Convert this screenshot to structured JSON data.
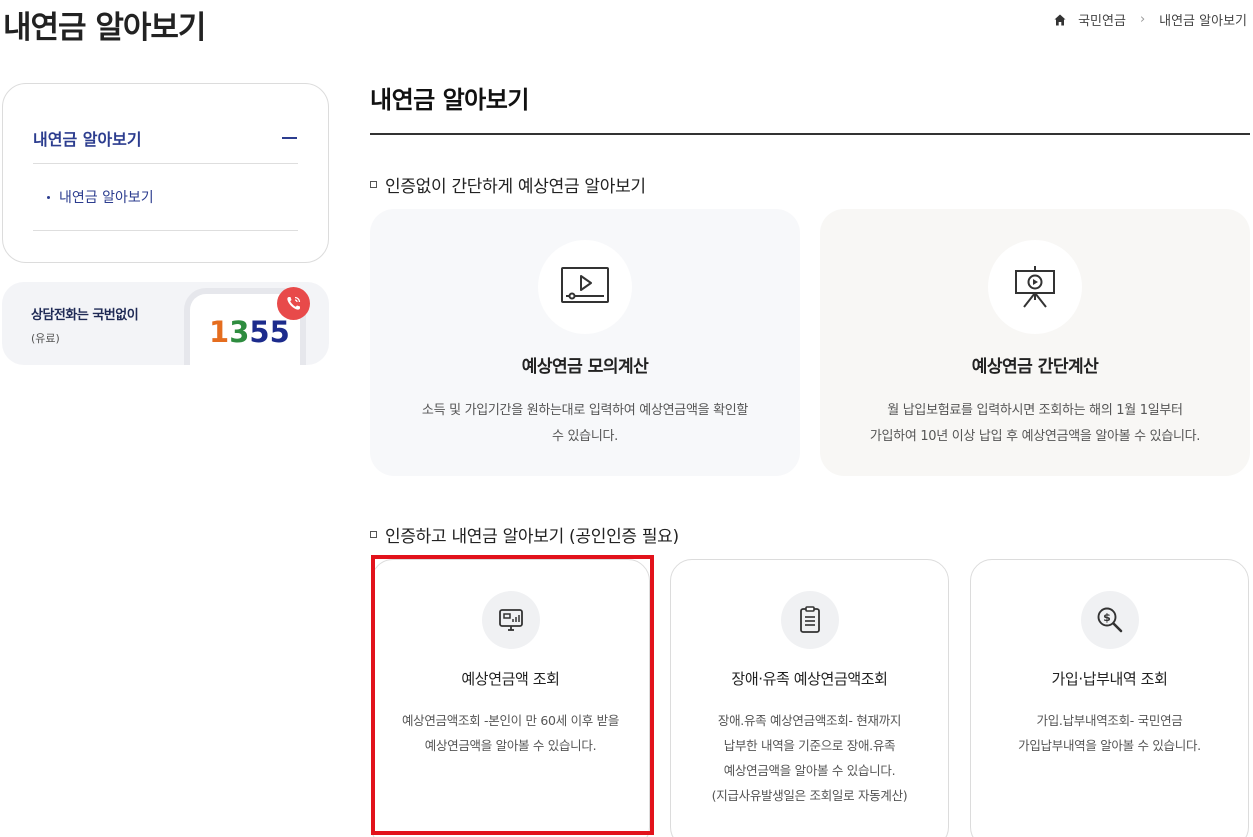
{
  "header": {
    "page_title": "내연금 알아보기",
    "breadcrumb": {
      "home": "국민연금",
      "current": "내연금 알아보기"
    }
  },
  "sidebar": {
    "menu_title": "내연금 알아보기",
    "sub_items": [
      {
        "label": "내연금 알아보기"
      }
    ],
    "call": {
      "title": "상담전화는 국번없이",
      "sub": "(유료)",
      "number_digits": [
        "1",
        "3",
        "5",
        "5"
      ]
    }
  },
  "main": {
    "title": "내연금 알아보기",
    "section1": {
      "title": "인증없이 간단하게 예상연금 알아보기",
      "cards": [
        {
          "title": "예상연금 모의계산",
          "desc_lines": [
            "소득 및 가입기간을 원하는대로 입력하여 예상연금액을 확인할",
            "수 있습니다."
          ]
        },
        {
          "title": "예상연금 간단계산",
          "desc_lines": [
            "월 납입보험료를 입력하시면 조회하는 해의 1월 1일부터",
            "가입하여 10년 이상 납입 후 예상연금액을 알아볼 수 있습니다."
          ]
        }
      ]
    },
    "section2": {
      "title": "인증하고 내연금 알아보기 (공인인증 필요)",
      "cards": [
        {
          "title": "예상연금액 조회",
          "desc_lines": [
            "예상연금액조회 -본인이 만 60세 이후 받을",
            "예상연금액을 알아볼 수 있습니다."
          ]
        },
        {
          "title": "장애·유족 예상연금액조회",
          "desc_lines": [
            "장애.유족 예상연금액조회- 현재까지",
            "납부한 내역을 기준으로 장애.유족",
            "예상연금액을 알아볼 수 있습니다.",
            "(지급사유발생일은 조회일로 자동계산)"
          ]
        },
        {
          "title": "가입·납부내역 조회",
          "desc_lines": [
            "가입.납부내역조회- 국민연금",
            "가입납부내역을 알아볼 수 있습니다."
          ]
        }
      ]
    }
  },
  "colors": {
    "accent": "#2c3d8f",
    "highlight": "#e2121b",
    "card_bg_1": "#f7f8fa",
    "card_bg_2": "#f8f7f5"
  }
}
